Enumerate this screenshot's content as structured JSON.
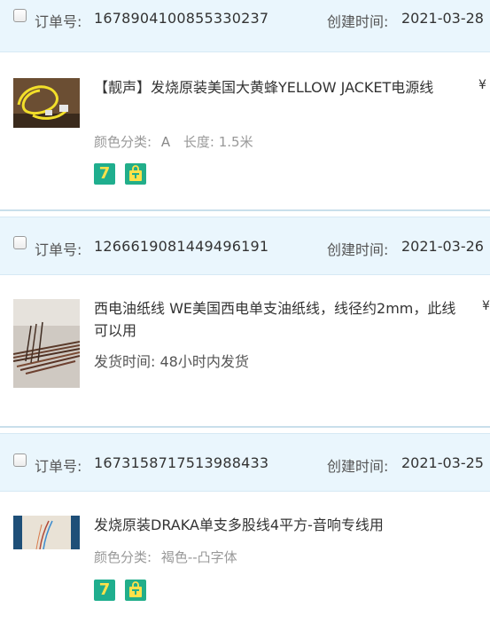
{
  "labels": {
    "order_no": "订单号:",
    "created": "创建时间:",
    "currency": "¥"
  },
  "orders": [
    {
      "order_no": "1678904100855330237",
      "created": "2021-03-28",
      "title": "【靓声】发烧原装美国大黄蜂YELLOW JACKET电源线",
      "attrs_label": "颜色分类:",
      "attrs_value": "A",
      "length_label": "长度:",
      "length_value": "1.5米",
      "badges": [
        "7",
        "bag"
      ]
    },
    {
      "order_no": "1266619081449496191",
      "created": "2021-03-26",
      "title": "西电油纸线 WE美国西电单支油纸线，线径约2mm，此线可以用",
      "ship_label": "发货时间:",
      "ship_value": "48小时内发货"
    },
    {
      "order_no": "1673158717513988433",
      "created": "2021-03-25",
      "title": "发烧原装DRAKA单支多股线4平方-音响专线用",
      "attrs_label": "颜色分类:",
      "attrs_value": "褐色--凸字体",
      "badges": [
        "7",
        "bag"
      ]
    }
  ],
  "icons": {
    "badge_7": "seven-day-return-icon",
    "badge_bag": "shopping-bag-icon"
  },
  "colors": {
    "header_bg": "#eaf6fd",
    "badge_bg": "#1fae8e",
    "badge_fg": "#ffe14a"
  }
}
